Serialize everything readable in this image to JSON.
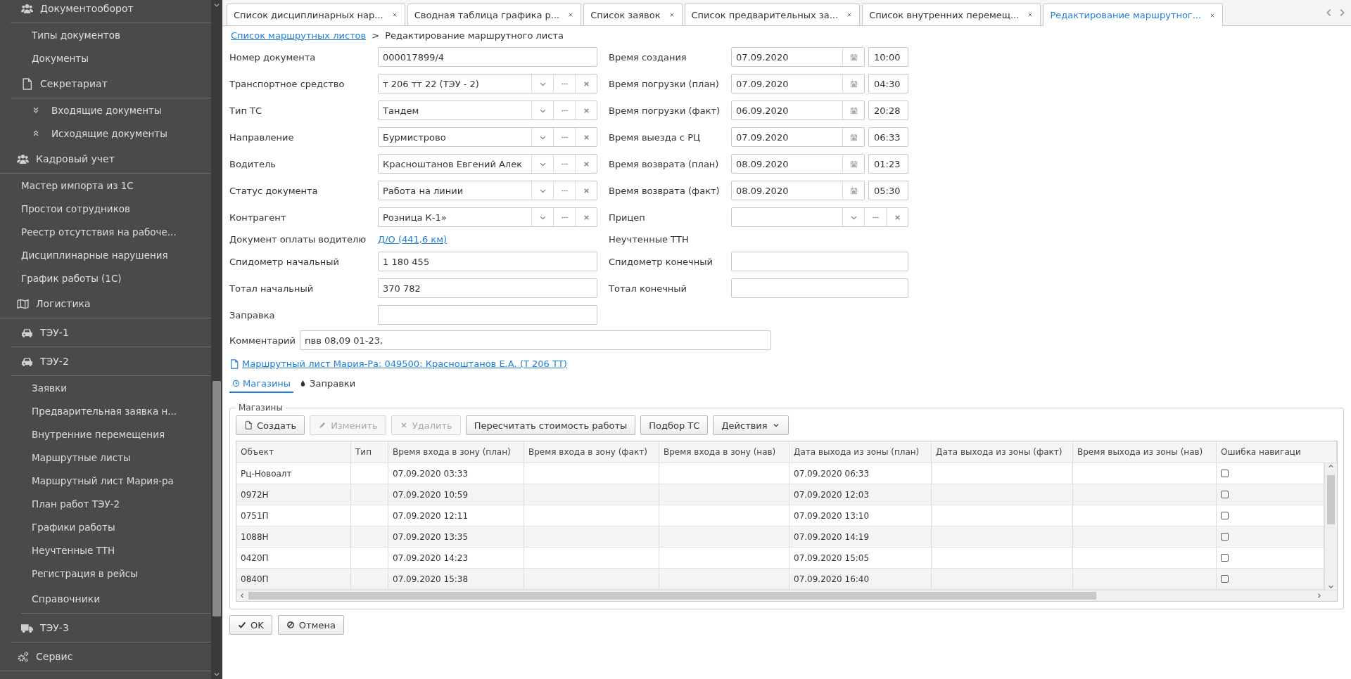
{
  "sidebar": {
    "continued": [
      {
        "label": "Документооборот",
        "kind": "users",
        "children": [
          {
            "label": "Типы документов",
            "kind": "link"
          },
          {
            "label": "Документы",
            "kind": "link"
          }
        ]
      },
      {
        "label": "Секретариат",
        "kind": "document",
        "children": [
          {
            "label": "Входящие документы",
            "kind": "chevron-down"
          },
          {
            "label": "Исходящие документы",
            "kind": "chevron-up"
          }
        ]
      }
    ],
    "items": [
      {
        "label": "Кадровый учет",
        "kind": "users",
        "children": [
          {
            "label": "Мастер импорта из 1С",
            "kind": "link"
          },
          {
            "label": "Простои сотрудников",
            "kind": "link"
          },
          {
            "label": "Реестр отсутствия на рабоче...",
            "kind": "link"
          },
          {
            "label": "Дисциплинарные нарушения",
            "kind": "link"
          },
          {
            "label": "График работы (1С)",
            "kind": "link"
          }
        ]
      },
      {
        "label": "Логистика",
        "kind": "map",
        "children": [
          {
            "label": "ТЭУ-1",
            "kind": "car"
          },
          {
            "label": "ТЭУ-2",
            "kind": "car",
            "children": [
              {
                "label": "Заявки",
                "kind": "link"
              },
              {
                "label": "Предварительная заявка н...",
                "kind": "link"
              },
              {
                "label": "Внутренние перемещения",
                "kind": "link"
              },
              {
                "label": "Маршрутные листы",
                "kind": "link"
              },
              {
                "label": "Маршрутный лист Мария-ра",
                "kind": "link"
              },
              {
                "label": "План работ ТЭУ-2",
                "kind": "link"
              },
              {
                "label": "Графики работы",
                "kind": "link"
              },
              {
                "label": "Неучтенные ТТН",
                "kind": "link"
              },
              {
                "label": "Регистрация в рейсы",
                "kind": "link"
              },
              {
                "label": "Справочники",
                "kind": "header"
              }
            ]
          },
          {
            "label": "ТЭУ-3",
            "kind": "truck"
          }
        ]
      },
      {
        "label": "Сервис",
        "kind": "gears"
      }
    ]
  },
  "tabs": [
    {
      "label": "Список дисциплинарных нар...",
      "selected": false
    },
    {
      "label": "Сводная таблица графика р...",
      "selected": false
    },
    {
      "label": "Список заявок",
      "selected": false
    },
    {
      "label": "Список предварительных за...",
      "selected": false
    },
    {
      "label": "Список внутренних перемещ...",
      "selected": false
    },
    {
      "label": "Редактирование маршрутног...",
      "selected": true
    }
  ],
  "breadcrumb": {
    "link": "Список маршрутных листов",
    "separator": ">",
    "current": "Редактирование маршрутного листа"
  },
  "form": {
    "rows": [
      {
        "left": {
          "label": "Номер документа",
          "kind": "text",
          "value": "000017899/4"
        },
        "right": {
          "label": "Время создания",
          "kind": "datetime",
          "date": "07.09.2020",
          "time": "10:00"
        }
      },
      {
        "left": {
          "label": "Транспортное средство",
          "kind": "lookup",
          "value": "т 206 тт 22 (ТЭУ - 2)"
        },
        "right": {
          "label": "Время погрузки (план)",
          "kind": "datetime",
          "date": "07.09.2020",
          "time": "04:30"
        }
      },
      {
        "left": {
          "label": "Тип ТС",
          "kind": "lookup",
          "value": "Тандем"
        },
        "right": {
          "label": "Время погрузки (факт)",
          "kind": "datetime",
          "date": "06.09.2020",
          "time": "20:28"
        }
      },
      {
        "left": {
          "label": "Направление",
          "kind": "lookup",
          "value": "Бурмистрово"
        },
        "right": {
          "label": "Время выезда с РЦ",
          "kind": "datetime",
          "date": "07.09.2020",
          "time": "06:33"
        }
      },
      {
        "left": {
          "label": "Водитель",
          "kind": "lookup",
          "value": "Красноштанов Евгений Алек"
        },
        "right": {
          "label": "Время возврата (план)",
          "kind": "datetime",
          "date": "08.09.2020",
          "time": "01:23"
        }
      },
      {
        "left": {
          "label": "Статус документа",
          "kind": "lookup",
          "value": "Работа на линии"
        },
        "right": {
          "label": "Время возврата (факт)",
          "kind": "datetime",
          "date": "08.09.2020",
          "time": "05:30"
        }
      },
      {
        "left": {
          "label": "Контрагент",
          "kind": "lookup",
          "value": "Розница К-1»"
        },
        "right": {
          "label": "Прицеп",
          "kind": "lookup"
        }
      },
      {
        "left": {
          "label": "Документ оплаты водителю",
          "kind": "link",
          "value": "Д/О (441,6 км)"
        },
        "right": {
          "label": "Неучтенные ТТН",
          "kind": "label"
        }
      },
      {
        "left": {
          "label": "Спидометр начальный",
          "kind": "text",
          "value": "1 180 455"
        },
        "right": {
          "label": "Спидометр конечный",
          "kind": "text"
        }
      },
      {
        "left": {
          "label": "Тотал начальный",
          "kind": "text",
          "value": "370 782"
        },
        "right": {
          "label": "Тотал конечный",
          "kind": "text"
        }
      },
      {
        "left": {
          "label": "Заправка",
          "kind": "text"
        }
      }
    ],
    "comment": {
      "label": "Комментарий",
      "value": "пвв 08,09 01-23,"
    }
  },
  "document_link": "Маршрутный лист Мария-Ра: 049500: Красноштанов Е.А. (Т 206 ТТ)",
  "sub_tabs": [
    {
      "label": "Магазины",
      "kind": "clock",
      "selected": true
    },
    {
      "label": "Заправки",
      "kind": "drop",
      "selected": false
    }
  ],
  "group": {
    "title": "Магазины",
    "toolbar": [
      {
        "label": "Создать",
        "kind": "create",
        "disabled": false
      },
      {
        "label": "Изменить",
        "kind": "edit",
        "disabled": true
      },
      {
        "label": "Удалить",
        "kind": "delete",
        "disabled": true
      },
      {
        "label": "Пересчитать стоимость работы",
        "kind": "plain",
        "disabled": false
      },
      {
        "label": "Подбор ТС",
        "kind": "plain",
        "disabled": false
      },
      {
        "label": "Действия",
        "kind": "menu",
        "disabled": false
      }
    ],
    "table": {
      "columns": [
        "Объект",
        "Тип",
        "Время входа в зону (план)",
        "Время входа в зону (факт)",
        "Время входа в зону (нав)",
        "Дата выхода из зоны (план)",
        "Дата выхода из зоны (факт)",
        "Время выхода из зоны (нав)",
        "Ошибка навигаци"
      ],
      "rows": [
        {
          "object": "Рц-Новоалт",
          "zone_in_plan": "07.09.2020 03:33",
          "zone_out_plan": "07.09.2020 06:33",
          "nav_error": false
        },
        {
          "object": "0972Н",
          "zone_in_plan": "07.09.2020 10:59",
          "zone_out_plan": "07.09.2020 12:03",
          "nav_error": false
        },
        {
          "object": "0751П",
          "zone_in_plan": "07.09.2020 12:11",
          "zone_out_plan": "07.09.2020 13:10",
          "nav_error": false
        },
        {
          "object": "1088Н",
          "zone_in_plan": "07.09.2020 13:35",
          "zone_out_plan": "07.09.2020 14:19",
          "nav_error": false
        },
        {
          "object": "0420П",
          "zone_in_plan": "07.09.2020 14:23",
          "zone_out_plan": "07.09.2020 15:05",
          "nav_error": false
        },
        {
          "object": "0840П",
          "zone_in_plan": "07.09.2020 15:38",
          "zone_out_plan": "07.09.2020 16:40",
          "nav_error": false
        }
      ]
    }
  },
  "actions": [
    {
      "label": "OK",
      "kind": "ok"
    },
    {
      "label": "Отмена",
      "kind": "cancel"
    }
  ]
}
